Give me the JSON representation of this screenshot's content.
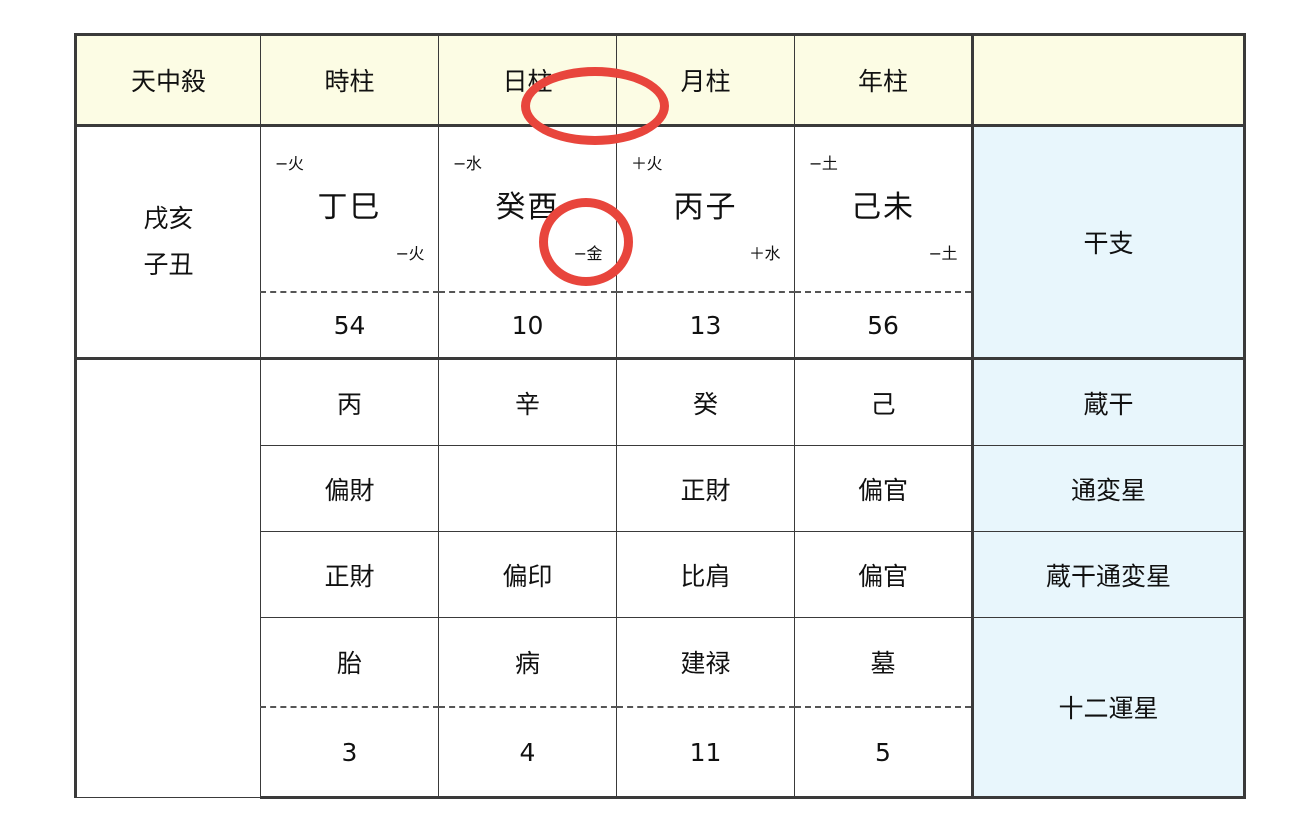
{
  "table": {
    "header": {
      "tenchusatsu": "天中殺",
      "pillars": [
        "時柱",
        "日柱",
        "月柱",
        "年柱"
      ],
      "label_blank": ""
    },
    "row_labels": {
      "kanshi": "干支",
      "zokan": "蔵干",
      "tsuhensei": "通変星",
      "zokan_tsuhensei": "蔵干通変星",
      "junishunsei": "十二運星"
    },
    "tenchusatsu": {
      "line1": "戌亥",
      "line2": "子丑"
    },
    "kanshi_row": {
      "pillars": [
        {
          "stem_element": "−火",
          "kanshi": "丁巳",
          "branch_element": "−火"
        },
        {
          "stem_element": "−水",
          "kanshi": "癸酉",
          "branch_element": "−金"
        },
        {
          "stem_element": "＋火",
          "kanshi": "丙子",
          "branch_element": "＋水"
        },
        {
          "stem_element": "−土",
          "kanshi": "己未",
          "branch_element": "−土"
        }
      ],
      "numbers": [
        "54",
        "10",
        "13",
        "56"
      ]
    },
    "zokan_row": [
      "丙",
      "辛",
      "癸",
      "己"
    ],
    "tsuhensei_row": [
      "偏財",
      "",
      "正財",
      "偏官"
    ],
    "zokan_tsuhensei_row": [
      "正財",
      "偏印",
      "比肩",
      "偏官"
    ],
    "junishunsei_row": {
      "stars": [
        "胎",
        "病",
        "建禄",
        "墓"
      ],
      "numbers": [
        "3",
        "4",
        "11",
        "5"
      ]
    }
  },
  "annotations": {
    "circle_color": "#e8453c",
    "circled_header": "日柱",
    "circled_kanshi": "癸酉"
  },
  "colors": {
    "header_bg": "#fcfce4",
    "label_bg": "#e8f6fc",
    "border": "#3a3a3a",
    "text": "#111111",
    "accent": "#e8453c"
  }
}
